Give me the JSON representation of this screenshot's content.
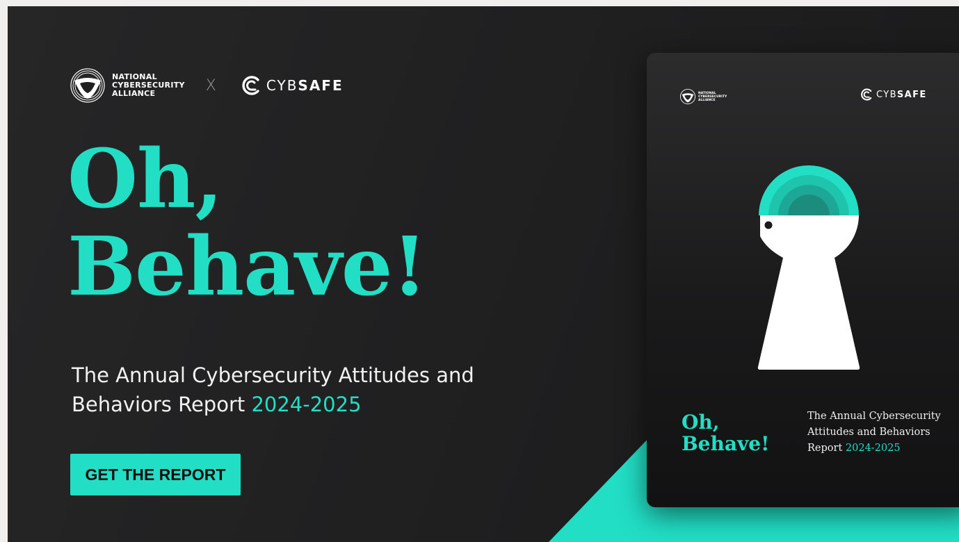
{
  "brand": {
    "accent": "#22dec5",
    "background": "#1f1f20",
    "text": "#ffffff"
  },
  "partner_logo": {
    "lines": [
      "NATIONAL",
      "CYBERSECURITY",
      "ALLIANCE"
    ]
  },
  "separator": "X",
  "cybsafe_logo": {
    "light_part": "CYB",
    "bold_part": "SAFE"
  },
  "headline": {
    "line1": "Oh,",
    "line2": "Behave!"
  },
  "subhead": {
    "text": "The Annual Cybersecurity Attitudes and Behaviors Report ",
    "year": "2024-2025"
  },
  "cta": {
    "label": "GET THE REPORT"
  },
  "report_cover": {
    "partner_lines": [
      "NATIONAL",
      "CYBERSECURITY",
      "ALLIANCE"
    ],
    "cyb_light": "CYB",
    "cyb_bold": "SAFE",
    "title_line1": "Oh,",
    "title_line2": "Behave!",
    "subtitle": "The Annual Cybersecurity Attitudes and Behaviors Report ",
    "year": "2024-2025",
    "illustration_icon": "keyhole-head-icon"
  }
}
